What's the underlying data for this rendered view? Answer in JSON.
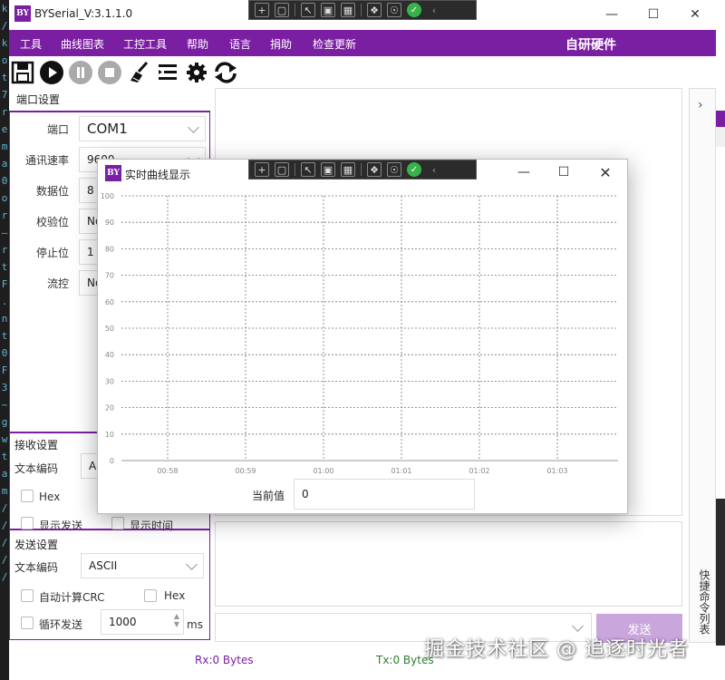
{
  "app": {
    "title": "BYSerial_V:3.1.1.0",
    "logo": "BY"
  },
  "colors": {
    "accent": "#7b1fa2",
    "send_button": "#c9a6dc",
    "rx": "#7b1fa2",
    "tx": "#2e7d32"
  },
  "menu": {
    "items": [
      "工具",
      "曲线图表",
      "工控工具",
      "帮助",
      "语言",
      "捐助",
      "检查更新"
    ],
    "brand": "自研硬件"
  },
  "toolbar": {
    "icons": [
      "save-icon",
      "play-icon",
      "pause-icon",
      "stop-icon",
      "broom-icon",
      "list-icon",
      "gear-icon",
      "refresh-icon"
    ]
  },
  "code_strip": [
    "k",
    "/",
    "k",
    "o",
    "t",
    "7",
    "r",
    "e",
    "m",
    "a",
    "0",
    "o",
    "r",
    "–",
    "r",
    "t",
    "F",
    ".",
    "n",
    "t",
    "0",
    "F",
    "3",
    "~",
    "g",
    "w",
    "t",
    "a",
    "m",
    "/",
    "/",
    "/",
    "/",
    "/"
  ],
  "port": {
    "title": "端口设置",
    "fields": [
      {
        "label": "端口",
        "value": "COM1"
      },
      {
        "label": "通讯速率",
        "value": "9600"
      },
      {
        "label": "数据位",
        "value": "8"
      },
      {
        "label": "校验位",
        "value": "No"
      },
      {
        "label": "停止位",
        "value": "1"
      },
      {
        "label": "流控",
        "value": "No"
      }
    ]
  },
  "receive": {
    "title": "接收设置",
    "encoding_label": "文本编码",
    "encoding_value": "A",
    "hex_label": "Hex",
    "show_send_label": "显示发送",
    "show_time_label": "显示时间"
  },
  "send": {
    "title": "发送设置",
    "encoding_label": "文本编码",
    "encoding_value": "ASCII",
    "crc_label": "自动计算CRC",
    "hex_label": "Hex",
    "loop_label": "循环发送",
    "loop_value": "1000",
    "loop_unit": "ms",
    "button": "发送"
  },
  "side_tab": {
    "label": "快捷命令列表"
  },
  "status": {
    "rx": "Rx:0 Bytes",
    "tx": "Tx:0 Bytes"
  },
  "chart_window": {
    "logo": "BY",
    "title": "实时曲线显示",
    "current_label": "当前值",
    "current_value": "0"
  },
  "chart_data": {
    "type": "line",
    "title": "",
    "xlabel": "",
    "ylabel": "",
    "ylim": [
      0,
      100
    ],
    "y_ticks": [
      "0",
      "10",
      "20",
      "30",
      "40",
      "50",
      "60",
      "70",
      "80",
      "90",
      "100"
    ],
    "x_ticks": [
      "00:58",
      "00:59",
      "01:00",
      "01:01",
      "01:02",
      "01:03"
    ],
    "grid": true,
    "series": []
  },
  "watermark": "掘金技术社区 @ 追逐时光者"
}
